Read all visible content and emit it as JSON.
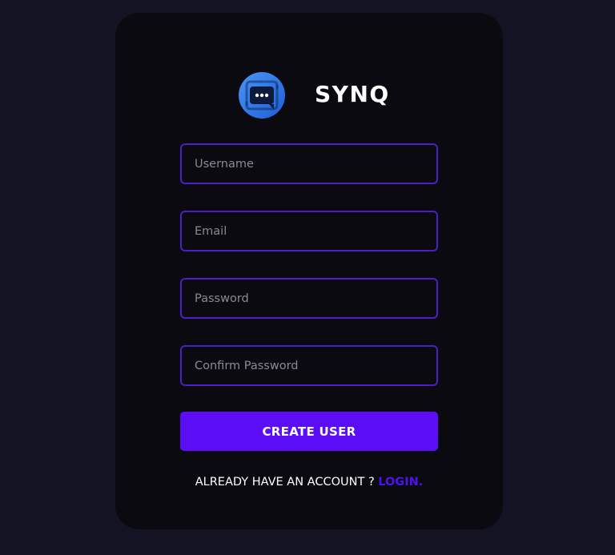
{
  "brand": {
    "icon": "chat-bubble-logo-icon",
    "name": "SYNQ"
  },
  "form": {
    "username_placeholder": "Username",
    "email_placeholder": "Email",
    "password_placeholder": "Password",
    "confirm_password_placeholder": "Confirm Password",
    "submit_label": "CREATE USER"
  },
  "footer": {
    "prompt": "ALREADY HAVE AN ACCOUNT ?",
    "login_label": "LOGIN."
  },
  "colors": {
    "page_background": "#131324",
    "card_background": "#0a0a10",
    "accent": "#5b0ef5",
    "input_border": "#4b1fc7",
    "logo_blue": "#3b82f6"
  }
}
